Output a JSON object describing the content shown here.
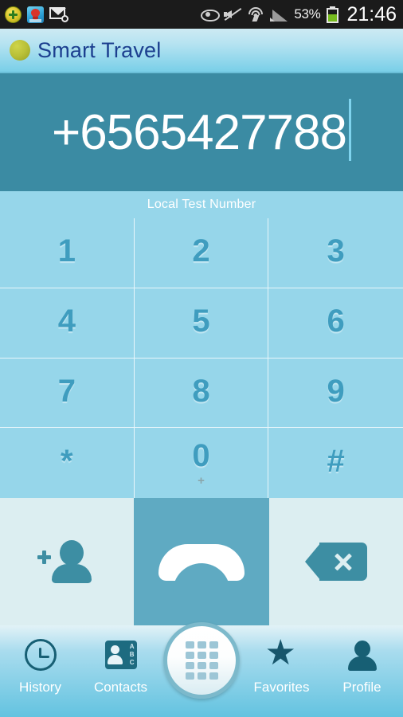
{
  "statusbar": {
    "left_icons": [
      "plus-circle-app-icon",
      "red-bird-app-icon",
      "email-at-icon"
    ],
    "right_icons": [
      "eye-icon",
      "mute-icon",
      "wifi-transfer-icon",
      "signal-bars-icon"
    ],
    "battery_percent": "53%",
    "battery_icon": "battery-icon",
    "time": "21:46"
  },
  "titlebar": {
    "logo_icon": "olive-dot-logo",
    "title": "Smart Travel"
  },
  "display": {
    "number": "+6565427788",
    "caret": "text-cursor",
    "bg_color": "#3b8ba3"
  },
  "keypad": {
    "label": "Local Test Number",
    "bg_color": "#96d6ea",
    "digit_color": "#3f9dbf",
    "keys": [
      {
        "digit": "1",
        "sub": ""
      },
      {
        "digit": "2",
        "sub": ""
      },
      {
        "digit": "3",
        "sub": ""
      },
      {
        "digit": "4",
        "sub": ""
      },
      {
        "digit": "5",
        "sub": ""
      },
      {
        "digit": "6",
        "sub": ""
      },
      {
        "digit": "7",
        "sub": ""
      },
      {
        "digit": "8",
        "sub": ""
      },
      {
        "digit": "9",
        "sub": ""
      },
      {
        "digit": "*",
        "sub": ""
      },
      {
        "digit": "0",
        "sub": "+"
      },
      {
        "digit": "#",
        "sub": ""
      }
    ]
  },
  "actions": {
    "add_contact_icon": "add-contact-icon",
    "call_icon": "phone-handset-icon",
    "call_bg_color": "#5faac2",
    "backspace_icon": "backspace-icon",
    "bg_color": "#dceef1"
  },
  "navbar": {
    "items": [
      {
        "label": "History",
        "icon": "clock-icon"
      },
      {
        "label": "Contacts",
        "icon": "contact-card-icon"
      },
      {
        "label": "Favorites",
        "icon": "star-icon"
      },
      {
        "label": "Profile",
        "icon": "person-icon"
      }
    ],
    "dial_button_icon": "keypad-grid-icon",
    "contacts_card_letters": "A\nB\nC",
    "star_glyph": "★"
  }
}
